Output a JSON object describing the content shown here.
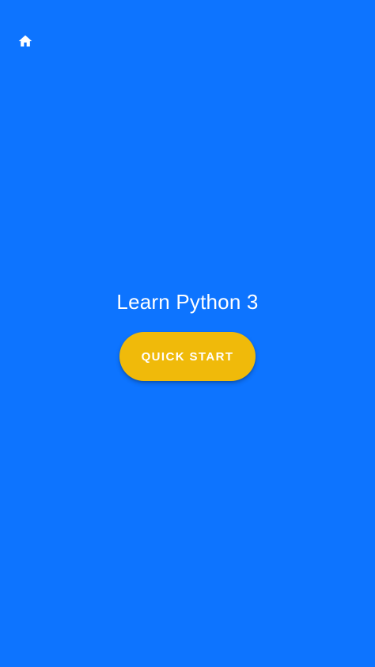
{
  "app": {
    "title": "Learn Python 3",
    "background_color": "#0D74FF"
  },
  "header": {
    "home_icon": "home-icon"
  },
  "main": {
    "quick_start_label": "QUICK START",
    "quick_start_color": "#F0BA0A"
  }
}
